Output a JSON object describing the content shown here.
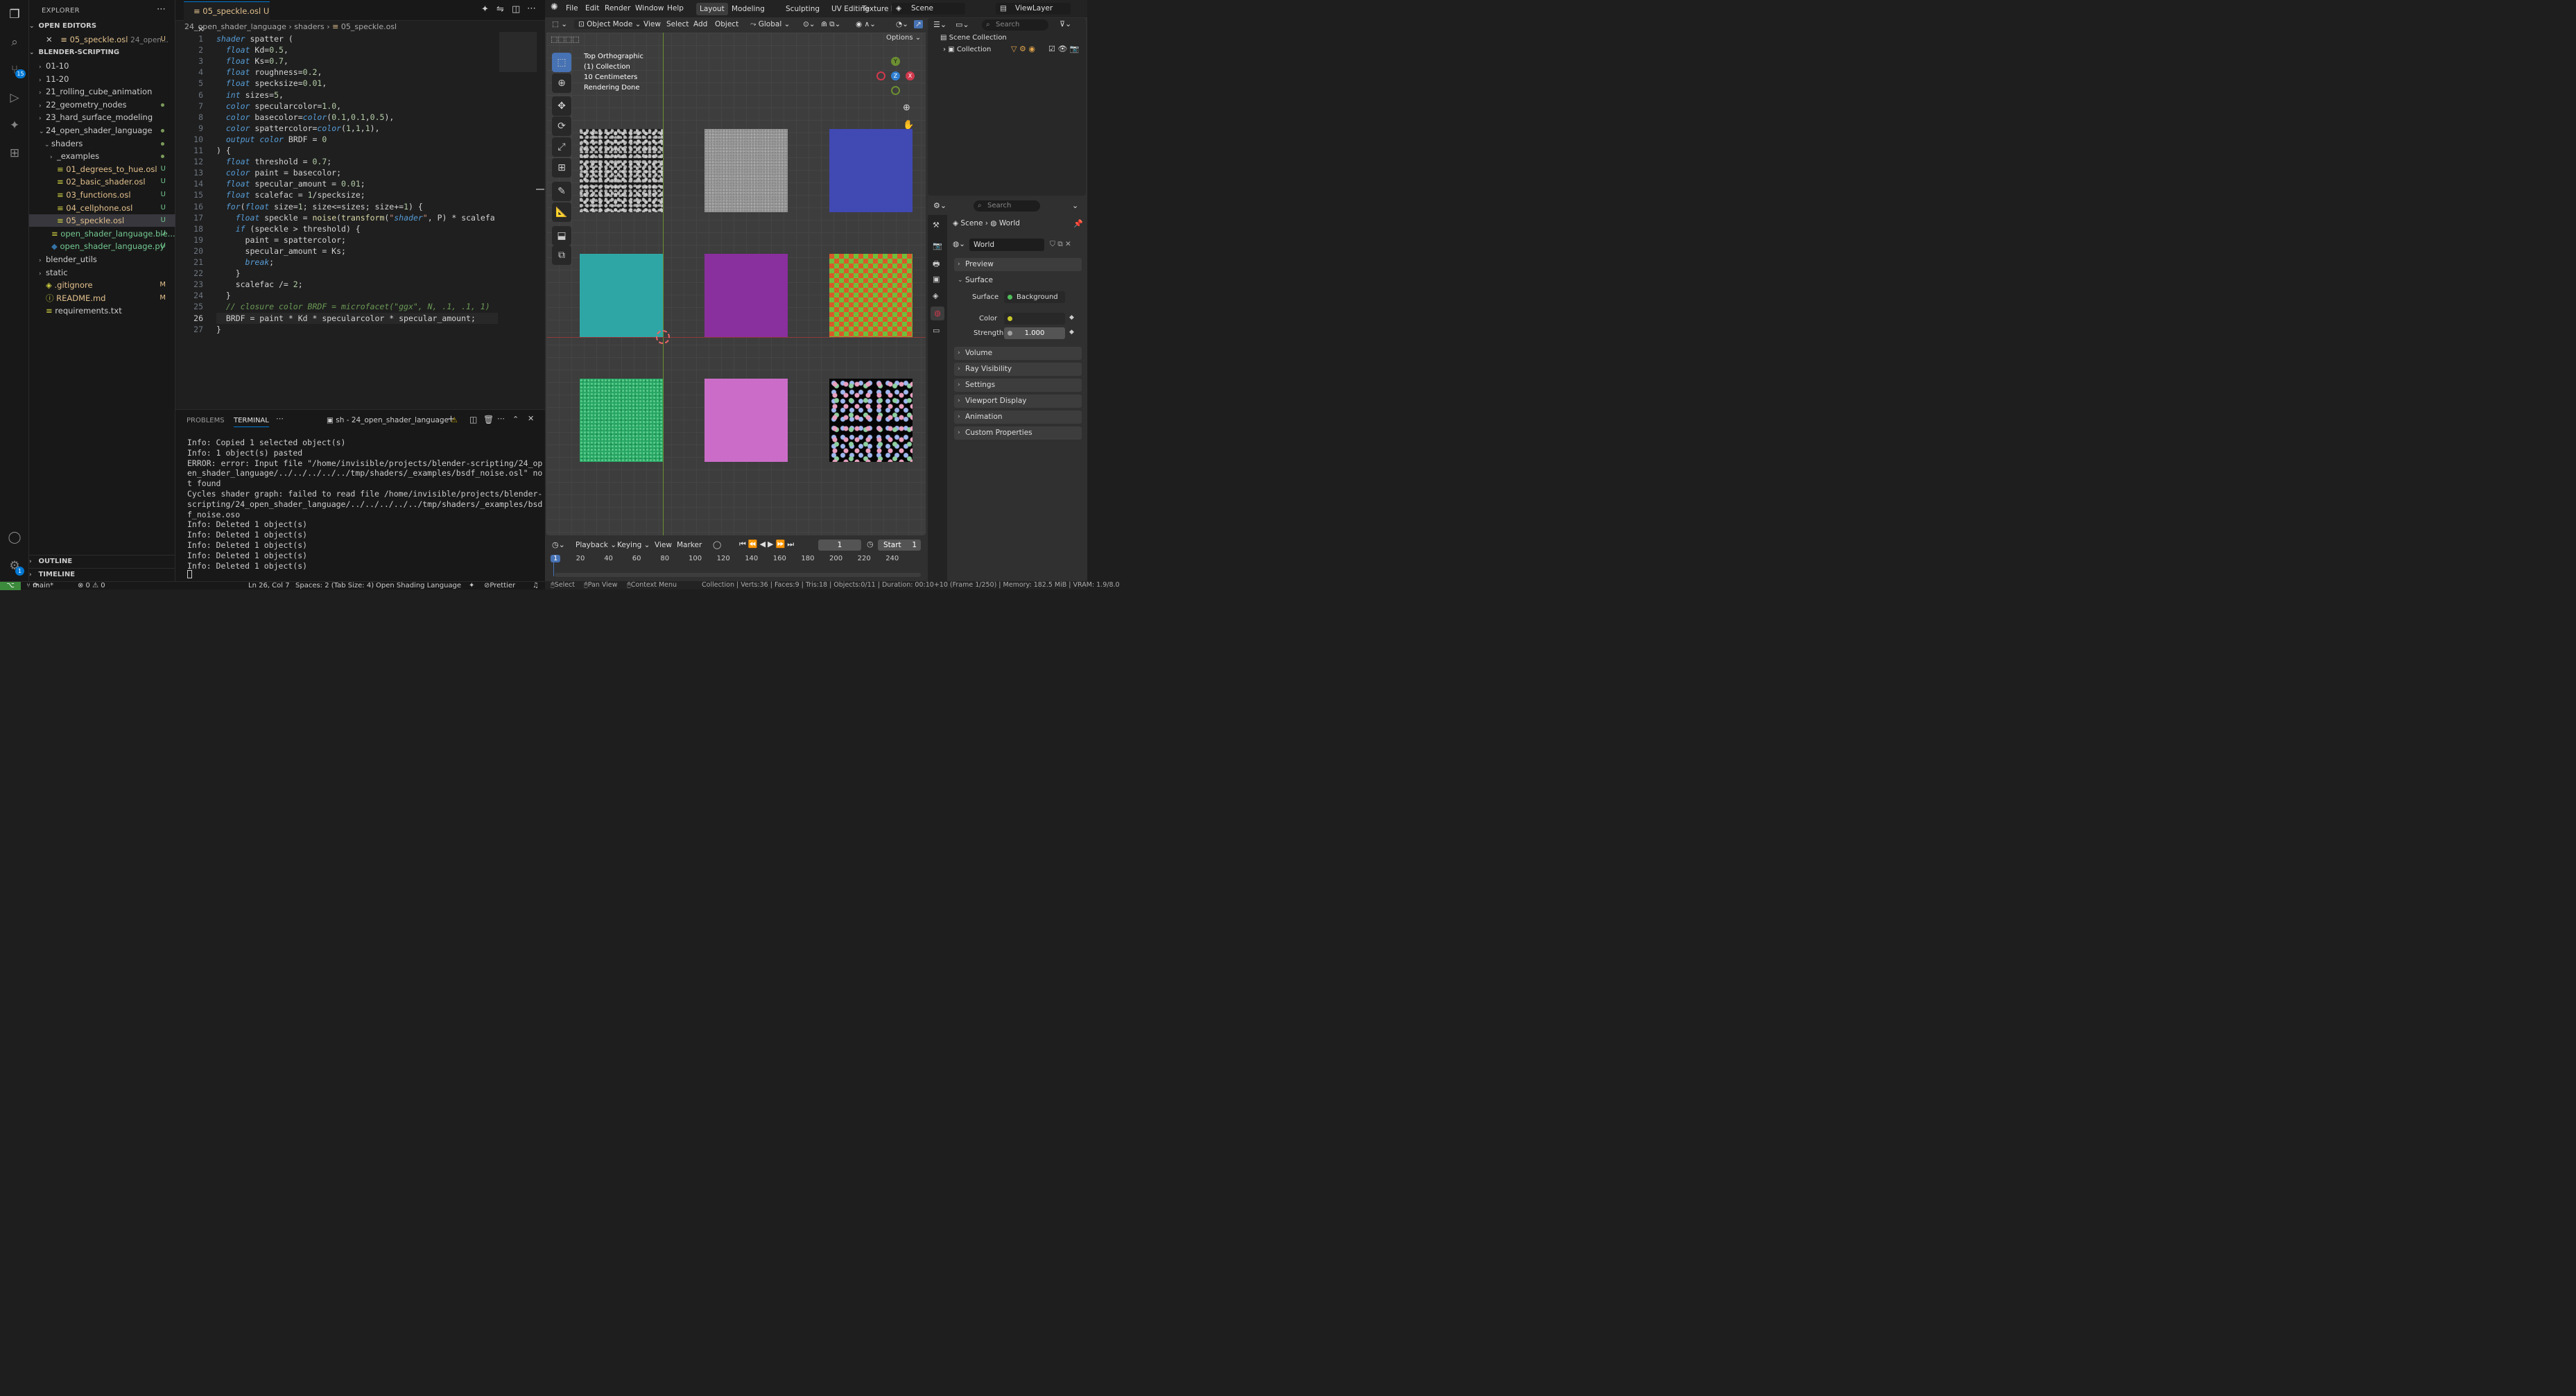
{
  "vscode": {
    "explorer": {
      "title": "EXPLORER",
      "open_editors_title": "OPEN EDITORS",
      "open_editor": {
        "name": "05_speckle.osl",
        "path": "24_open...",
        "status": "U"
      },
      "root_title": "BLENDER-SCRIPTING",
      "items": [
        {
          "label": "01-10",
          "status": ""
        },
        {
          "label": "11-20",
          "status": ""
        },
        {
          "label": "21_rolling_cube_animation",
          "status": ""
        },
        {
          "label": "22_geometry_nodes",
          "status": "•"
        },
        {
          "label": "23_hard_surface_modeling",
          "status": ""
        },
        {
          "label": "24_open_shader_language",
          "status": "•"
        },
        {
          "label": "shaders",
          "status": "•"
        },
        {
          "label": "_examples",
          "status": "•"
        },
        {
          "label": "01_degrees_to_hue.osl",
          "status": "U"
        },
        {
          "label": "02_basic_shader.osl",
          "status": "U"
        },
        {
          "label": "03_functions.osl",
          "status": "U"
        },
        {
          "label": "04_cellphone.osl",
          "status": "U"
        },
        {
          "label": "05_speckle.osl",
          "status": "U"
        },
        {
          "label": "open_shader_language.ble...",
          "status": "U"
        },
        {
          "label": "open_shader_language.py",
          "status": "U"
        },
        {
          "label": "blender_utils",
          "status": ""
        },
        {
          "label": "static",
          "status": ""
        },
        {
          "label": ".gitignore",
          "status": "M"
        },
        {
          "label": "README.md",
          "status": "M"
        },
        {
          "label": "requirements.txt",
          "status": ""
        }
      ],
      "outline_title": "OUTLINE",
      "timeline_title": "TIMELINE"
    },
    "activity_badge_scm": "15",
    "activity_badge_settings": "1",
    "tab": {
      "name": "05_speckle.osl",
      "status": "U"
    },
    "breadcrumb": [
      "24_open_shader_language",
      "shaders",
      "05_speckle.osl"
    ],
    "code_lines": [
      "shader spatter (",
      "  float Kd=0.5,",
      "  float Ks=0.7,",
      "  float roughness=0.2,",
      "  float specksize=0.01,",
      "  int sizes=5,",
      "  color specularcolor=1.0,",
      "  color basecolor=color(0.1,0.1,0.5),",
      "  color spattercolor=color(1,1,1),",
      "  output color BRDF = 0",
      ") {",
      "  float threshold = 0.7;",
      "  color paint = basecolor;",
      "  float specular_amount = 0.01;",
      "  float scalefac = 1/specksize;",
      "  for(float size=1; size<=sizes; size+=1) {",
      "    float speckle = noise(transform(\"shader\", P) * scalefa",
      "    if (speckle > threshold) {",
      "      paint = spattercolor;",
      "      specular_amount = Ks;",
      "      break;",
      "    }",
      "    scalefac /= 2;",
      "  }",
      "  // closure color BRDF = microfacet(\"ggx\", N, .1, .1, 1)",
      "  BRDF = paint * Kd * specularcolor * specular_amount;",
      "}"
    ],
    "panel": {
      "tabs": [
        "PROBLEMS",
        "TERMINAL"
      ],
      "terminal_name": "sh - 24_open_shader_language",
      "terminal_lines": [
        "Info: Copied 1 selected object(s)",
        "Info: 1 object(s) pasted",
        "ERROR: error: Input file \"/home/invisible/projects/blender-scripting/24_op",
        "en_shader_language/../../../../../tmp/shaders/_examples/bsdf_noise.osl\" no",
        "t found",
        "Cycles shader graph: failed to read file /home/invisible/projects/blender-",
        "scripting/24_open_shader_language/../../../../../tmp/shaders/_examples/bsd",
        "f_noise.oso",
        "Info: Deleted 1 object(s)",
        "Info: Deleted 1 object(s)",
        "Info: Deleted 1 object(s)",
        "Info: Deleted 1 object(s)",
        "Info: Deleted 1 object(s)"
      ]
    },
    "status": {
      "branch": "main*",
      "problems": "⊗ 0 ⚠ 0",
      "position": "Ln 26, Col 7",
      "indent": "Spaces: 2 (Tab Size: 4)",
      "language": "Open Shading Language",
      "formatter": "Prettier"
    }
  },
  "blender": {
    "menus": [
      "File",
      "Edit",
      "Render",
      "Window",
      "Help"
    ],
    "workspaces": [
      "Layout",
      "Modeling",
      "Sculpting",
      "UV Editing",
      "Texture P"
    ],
    "scene": "Scene",
    "view_layer": "ViewLayer",
    "viewport": {
      "mode": "Object Mode",
      "menu": [
        "View",
        "Select",
        "Add",
        "Object"
      ],
      "orientation": "Global",
      "options": "Options",
      "overlay_lines": [
        "Top Orthographic",
        "(1) Collection",
        "10 Centimeters",
        "Rendering Done"
      ]
    },
    "tiles": [
      {
        "name": "spatter-black-white",
        "color": "#1a1a1a"
      },
      {
        "name": "noise-gray",
        "color": "#9a9a9a"
      },
      {
        "name": "blue",
        "color": "#4149b3"
      },
      {
        "name": "teal",
        "color": "#2fa6a6"
      },
      {
        "name": "purple",
        "color": "#8a2f9e"
      },
      {
        "name": "checker-red-green",
        "color": "#d85a2a"
      },
      {
        "name": "green-speckle",
        "color": "#27a564"
      },
      {
        "name": "pink",
        "color": "#cb6dc8"
      },
      {
        "name": "polka-dots",
        "color": "#050505"
      }
    ],
    "timeline": {
      "menu": [
        "Playback",
        "Keying",
        "View",
        "Marker"
      ],
      "current_frame": "1",
      "start_label": "Start",
      "start_value": "1",
      "ticks": [
        "1",
        "20",
        "40",
        "60",
        "80",
        "100",
        "120",
        "140",
        "160",
        "180",
        "200",
        "220",
        "240"
      ]
    },
    "outliner": {
      "search_placeholder": "Search",
      "scene_collection": "Scene Collection",
      "collection": "Collection"
    },
    "properties": {
      "search_placeholder": "Search",
      "breadcrumb": [
        "Scene",
        "World"
      ],
      "world_name": "World",
      "sections": [
        "Preview",
        "Surface",
        "Volume",
        "Ray Visibility",
        "Settings",
        "Viewport Display",
        "Animation",
        "Custom Properties"
      ],
      "surface_label": "Surface",
      "surface_value": "Background",
      "color_label": "Color",
      "strength_label": "Strength",
      "strength_value": "1.000"
    },
    "status": {
      "select": "Select",
      "pan": "Pan View",
      "context": "Context Menu",
      "stats": "Collection | Verts:36 | Faces:9 | Tris:18 | Objects:0/11 | Duration: 00:10+10 (Frame 1/250) | Memory: 182.5 MiB | VRAM: 1.9/8.0"
    }
  }
}
